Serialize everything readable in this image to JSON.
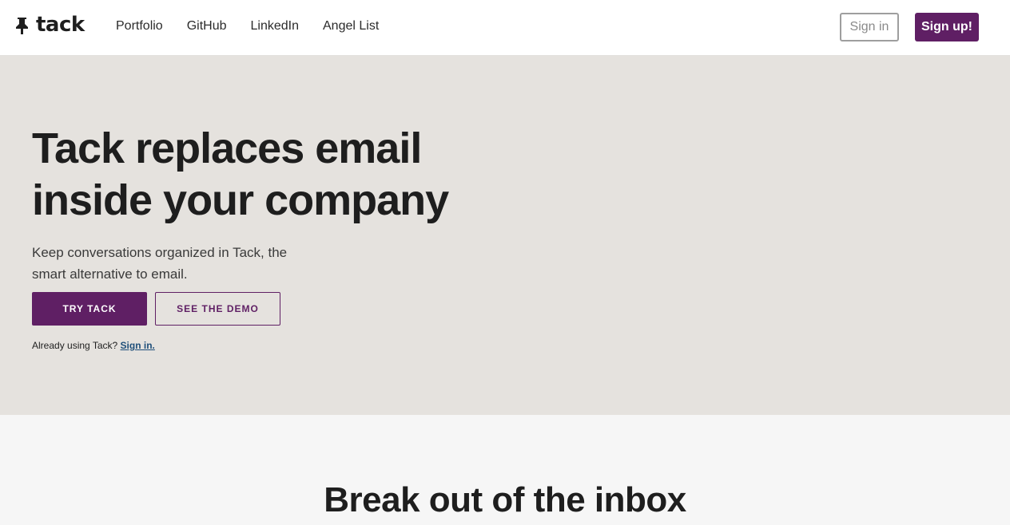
{
  "brand": {
    "name": "tack",
    "icon": "pushpin-icon",
    "color": "#5f1f64"
  },
  "nav": {
    "links": [
      {
        "label": "Portfolio"
      },
      {
        "label": "GitHub"
      },
      {
        "label": "LinkedIn"
      },
      {
        "label": "Angel List"
      }
    ],
    "signin_label": "Sign in",
    "signup_label": "Sign up!"
  },
  "hero": {
    "title": "Tack replaces email inside your company",
    "subtitle": "Keep conversations organized in Tack, the smart alternative to email.",
    "primary_button": "TRY TACK",
    "secondary_button": "SEE THE DEMO",
    "already_text": "Already using Tack?",
    "already_link": "Sign in.",
    "background": "#e5e2de"
  },
  "section": {
    "title": "Break out of the inbox"
  }
}
